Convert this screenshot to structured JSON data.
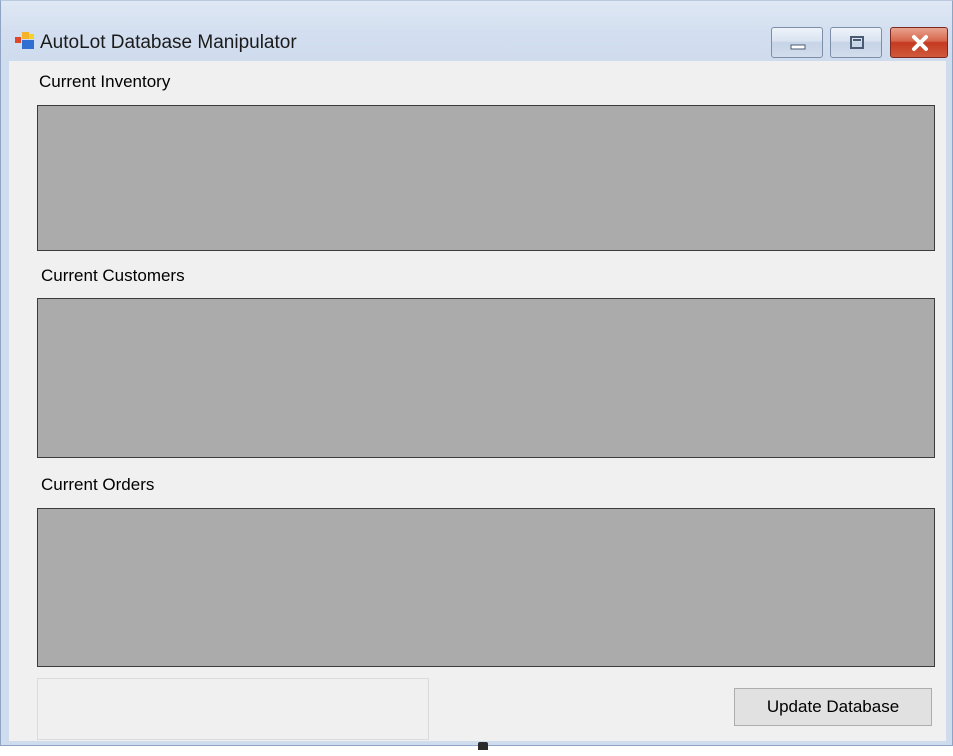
{
  "window": {
    "title": "AutoLot Database Manipulator",
    "icon": "windows-forms-app-icon",
    "controls": {
      "minimize": "minimize-icon",
      "maximize": "restore-icon",
      "close": "close-icon"
    },
    "close_color": "#c43a20",
    "frame_color": "#cfdcee"
  },
  "sections": {
    "inventory": {
      "label": "Current Inventory"
    },
    "customers": {
      "label": "Current Customers"
    },
    "orders": {
      "label": "Current Orders"
    }
  },
  "grid_color": "#ababab",
  "actions": {
    "update_label": "Update Database"
  }
}
